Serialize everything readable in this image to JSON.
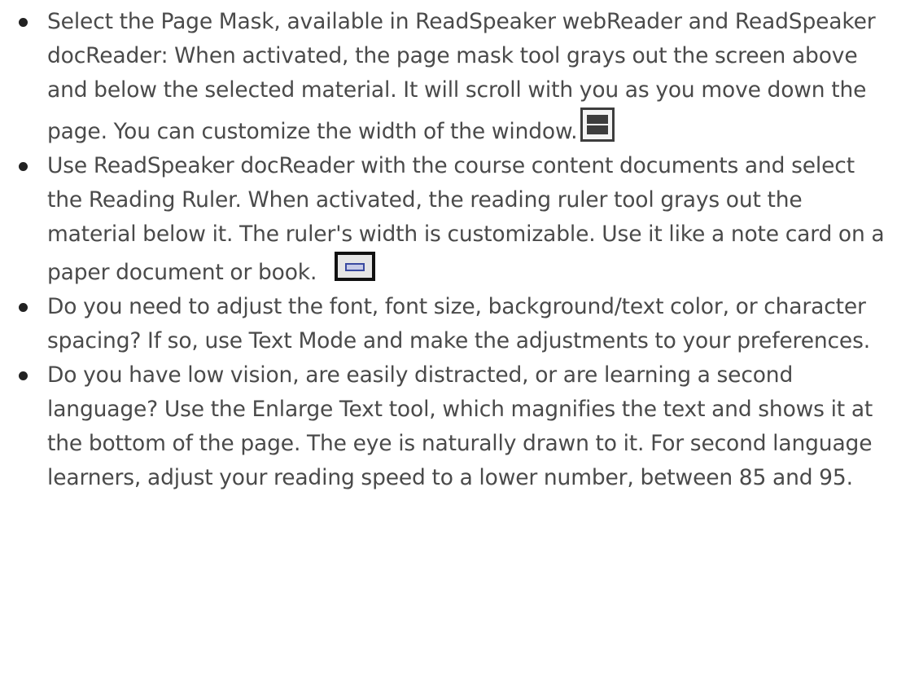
{
  "bullets": [
    {
      "text": "Select the Page Mask, available in ReadSpeaker webReader and ReadSpeaker docReader:   When activated, the page mask tool grays out the screen above and below the selected material.  It will scroll with you as you move down the page. You can customize the width of the window.",
      "icon": "page-mask-icon"
    },
    {
      "text": "Use ReadSpeaker docReader with the course content documents and select the Reading Ruler. When activated, the reading ruler tool grays out the material below it. The ruler's width is customizable. Use it like a note card on a paper document or book.",
      "icon": "reading-ruler-icon"
    },
    {
      "text": "Do you need to adjust the font, font size, background/text color, or character spacing? If so, use Text Mode and make the adjustments to your preferences."
    },
    {
      "text": "Do you have low vision, are easily distracted, or are learning a second language? Use the Enlarge Text tool, which magnifies the text and shows it at the bottom of the page. The eye is naturally drawn to it. For second language learners, adjust your reading speed to a lower number, between 85 and 95."
    }
  ],
  "colors": {
    "text": "#4a4a4a",
    "bullet": "#222222",
    "icon_dark": "#3d3d3d",
    "ruler_blue": "#3a4aa0"
  }
}
